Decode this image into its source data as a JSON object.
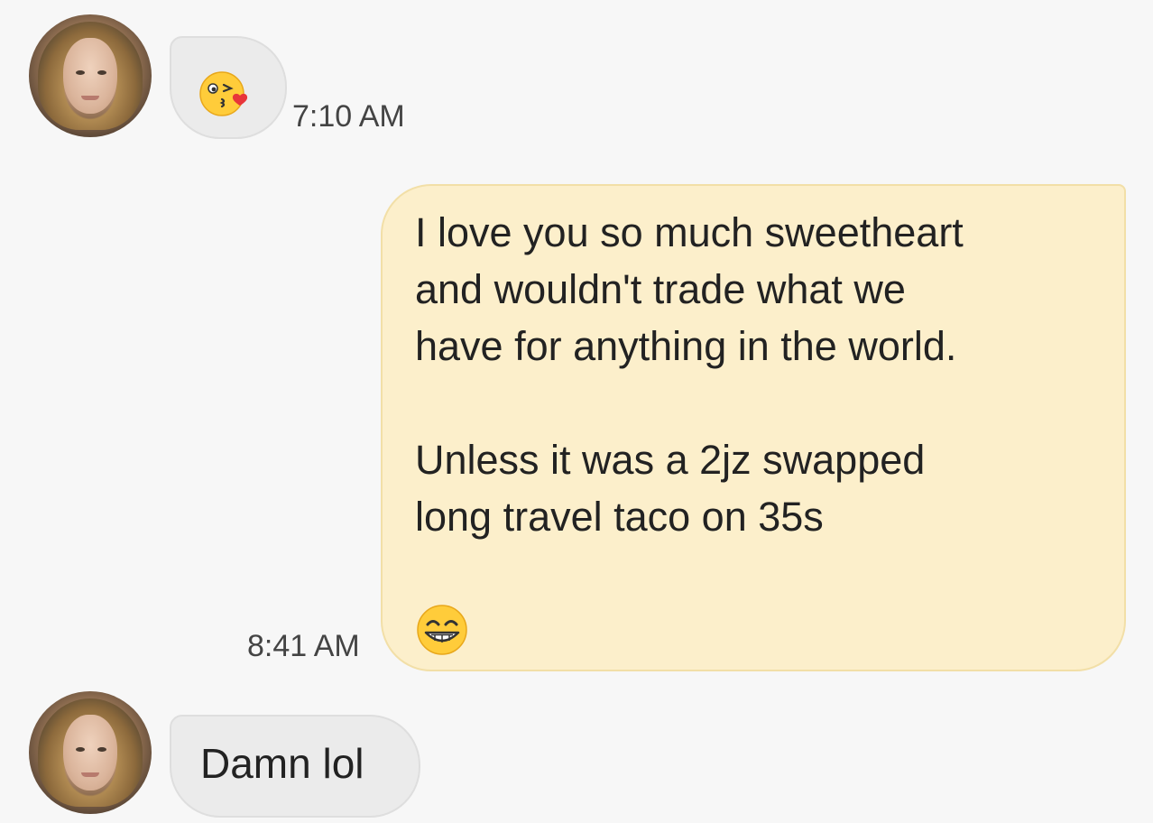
{
  "messages": [
    {
      "sender": "contact",
      "emoji": "kissing-heart-emoji",
      "time": "7:10 AM"
    },
    {
      "sender": "me",
      "text": "I love you so much sweetheart\nand wouldn't trade what we\nhave for anything in the world.\n\nUnless it was a 2jz swapped\nlong travel taco on 35s",
      "emoji": "grinning-emoji",
      "time": "8:41 AM"
    },
    {
      "sender": "contact",
      "text": "Damn lol"
    }
  ],
  "colors": {
    "background": "#f7f7f7",
    "incoming_bubble": "#ebebeb",
    "outgoing_bubble": "#fcefcb"
  }
}
